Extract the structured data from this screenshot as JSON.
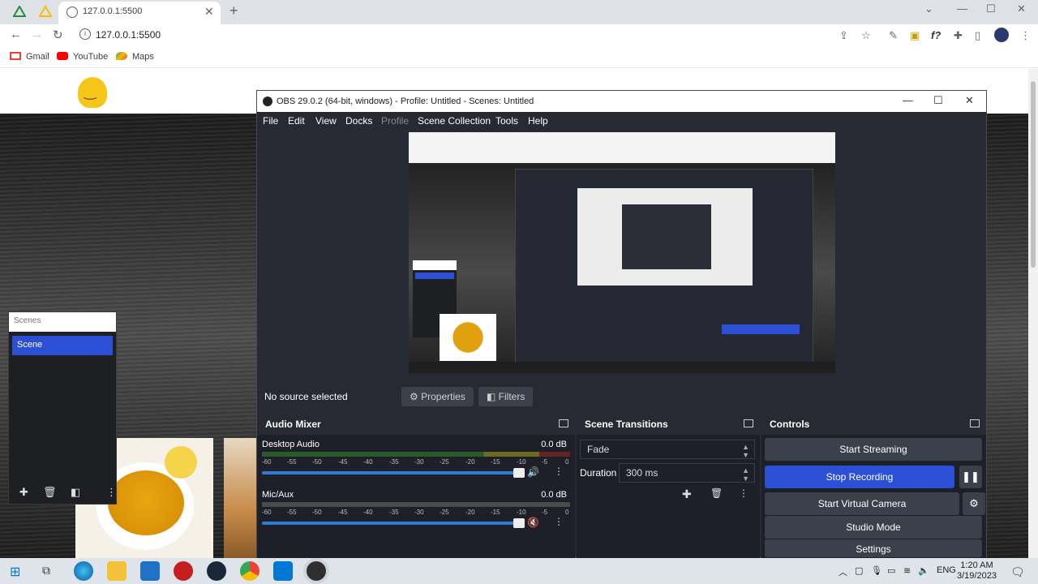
{
  "browser": {
    "tab_title": "127.0.0.1:5500",
    "url": "127.0.0.1:5500",
    "bookmarks": [
      "Gmail",
      "YouTube",
      "Maps"
    ]
  },
  "page_scenes": {
    "header": "Scenes",
    "scene": "Scene"
  },
  "obs": {
    "title": "OBS 29.0.2 (64-bit, windows) - Profile: Untitled - Scenes: Untitled",
    "menu": [
      "File",
      "Edit",
      "View",
      "Docks",
      "Profile",
      "Scene Collection",
      "Tools",
      "Help"
    ],
    "source_bar": {
      "status": "No source selected",
      "properties": "Properties",
      "filters": "Filters"
    },
    "audio_mixer": {
      "title": "Audio Mixer",
      "ticks": [
        "-60",
        "-55",
        "-50",
        "-45",
        "-40",
        "-35",
        "-30",
        "-25",
        "-20",
        "-15",
        "-10",
        "-5",
        "0"
      ],
      "channels": [
        {
          "name": "Desktop Audio",
          "db": "0.0 dB"
        },
        {
          "name": "Mic/Aux",
          "db": "0.0 dB"
        }
      ]
    },
    "scene_transitions": {
      "title": "Scene Transitions",
      "transition": "Fade",
      "duration_label": "Duration",
      "duration_value": "300 ms"
    },
    "controls": {
      "title": "Controls",
      "start_streaming": "Start Streaming",
      "stop_recording": "Stop Recording",
      "start_virtual_camera": "Start Virtual Camera",
      "studio_mode": "Studio Mode",
      "settings": "Settings"
    }
  },
  "taskbar": {
    "language": "ENG",
    "time": "1:20 AM",
    "date": "3/19/2023"
  },
  "colors": {
    "obs_bg": "#272a33",
    "accent_blue": "#2b50d6",
    "chrome_tabbar": "#dee1e6"
  }
}
